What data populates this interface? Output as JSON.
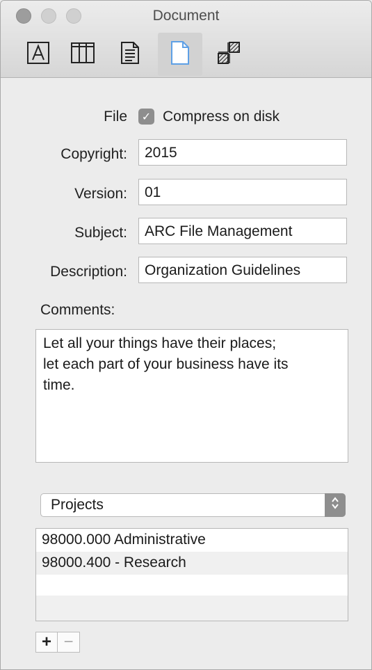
{
  "window": {
    "title": "Document"
  },
  "toolbar": {
    "items": [
      {
        "name": "font-icon",
        "selected": false
      },
      {
        "name": "columns-icon",
        "selected": false
      },
      {
        "name": "text-page-icon",
        "selected": false
      },
      {
        "name": "document-icon",
        "selected": true
      },
      {
        "name": "pattern-icon",
        "selected": false
      }
    ]
  },
  "form": {
    "file_label": "File",
    "compress_label": "Compress on disk",
    "compress_checked": true,
    "copyright_label": "Copyright:",
    "copyright_value": "2015",
    "version_label": "Version:",
    "version_value": "01",
    "subject_label": "Subject:",
    "subject_value": "ARC File Management",
    "description_label": "Description:",
    "description_value": "Organization Guidelines",
    "comments_label": "Comments:",
    "comments_value": "Let all your things have their places;\nlet each part of your business have its\ntime."
  },
  "projects": {
    "popup_value": "Projects",
    "rows": [
      "98000.000 Administrative",
      "98000.400 - Research"
    ],
    "add_label": "+",
    "remove_label": "−"
  },
  "colors": {
    "window_bg": "#ececec",
    "selected_tab": "#d2d2d2",
    "accent_icon": "#5ea0e6",
    "checkbox": "#8e8e8e"
  }
}
